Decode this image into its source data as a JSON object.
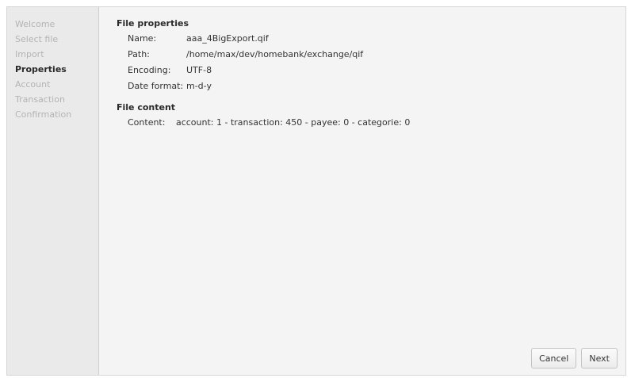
{
  "sidebar": {
    "steps": [
      {
        "label": "Welcome"
      },
      {
        "label": "Select file"
      },
      {
        "label": "Import"
      },
      {
        "label": "Properties"
      },
      {
        "label": "Account"
      },
      {
        "label": "Transaction"
      },
      {
        "label": "Confirmation"
      }
    ],
    "active_step": "Properties"
  },
  "file_properties": {
    "title": "File properties",
    "rows": [
      {
        "key": "Name:",
        "value": "aaa_4BigExport.qif"
      },
      {
        "key": "Path:",
        "value": "/home/max/dev/homebank/exchange/qif"
      },
      {
        "key": "Encoding:",
        "value": "UTF-8"
      },
      {
        "key": "Date format:",
        "value": "m-d-y"
      }
    ]
  },
  "file_content": {
    "title": "File content",
    "key": "Content:",
    "value": "account: 1 - transaction: 450 - payee: 0 - categorie: 0"
  },
  "buttons": {
    "cancel_label": "Cancel",
    "next_label": "Next"
  }
}
